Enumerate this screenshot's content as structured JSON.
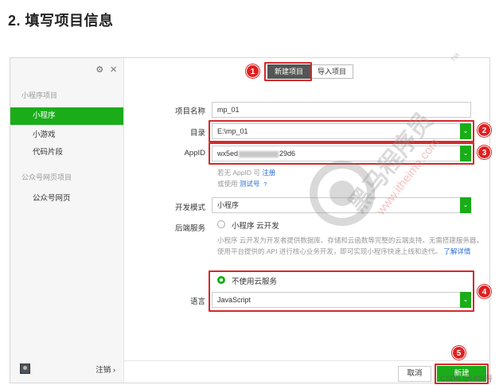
{
  "heading": "2. 填写项目信息",
  "sidebar": {
    "groups": [
      {
        "label": "小程序项目"
      },
      {
        "label": "公众号网页项目"
      }
    ],
    "items": [
      {
        "label": "小程序"
      },
      {
        "label": "小游戏"
      },
      {
        "label": "代码片段"
      },
      {
        "label": "公众号网页"
      }
    ],
    "logout": "注销 ›"
  },
  "tabs": [
    {
      "label": "新建项目"
    },
    {
      "label": "导入项目"
    }
  ],
  "form": {
    "project_name": {
      "label": "项目名称",
      "value": "mp_01"
    },
    "directory": {
      "label": "目录",
      "value": "E:\\mp_01"
    },
    "appid": {
      "label": "AppID",
      "value_prefix": "wx5ed",
      "value_suffix": "29d6"
    },
    "appid_hint": {
      "line1_text": "若无 AppID 可",
      "line1_link": "注册",
      "line2_text": "或使用",
      "line2_link": "测试号",
      "qmark": "?"
    },
    "dev_mode": {
      "label": "开发模式",
      "value": "小程序"
    },
    "backend": {
      "label": "后端服务",
      "option": "小程序 云开发",
      "description": "小程序 云开发为开发者提供数据库、存储和云函数等完整的云端支持。无需搭建服务器，使用平台提供的 API 进行核心业务开发，即可实现小程序快速上线和迭代。",
      "learn_more": "了解详情"
    },
    "no_cloud": {
      "label": "不使用云服务"
    },
    "language": {
      "label": "语言",
      "value": "JavaScript"
    }
  },
  "buttons": {
    "cancel": "取消",
    "create": "新建"
  },
  "badges": [
    "1",
    "2",
    "3",
    "4",
    "5"
  ],
  "watermark": {
    "brand": "黑马程序员",
    "url": "www.itheima.com",
    "tm": "TM"
  },
  "csdn_tag": "CSDN @HRN号"
}
